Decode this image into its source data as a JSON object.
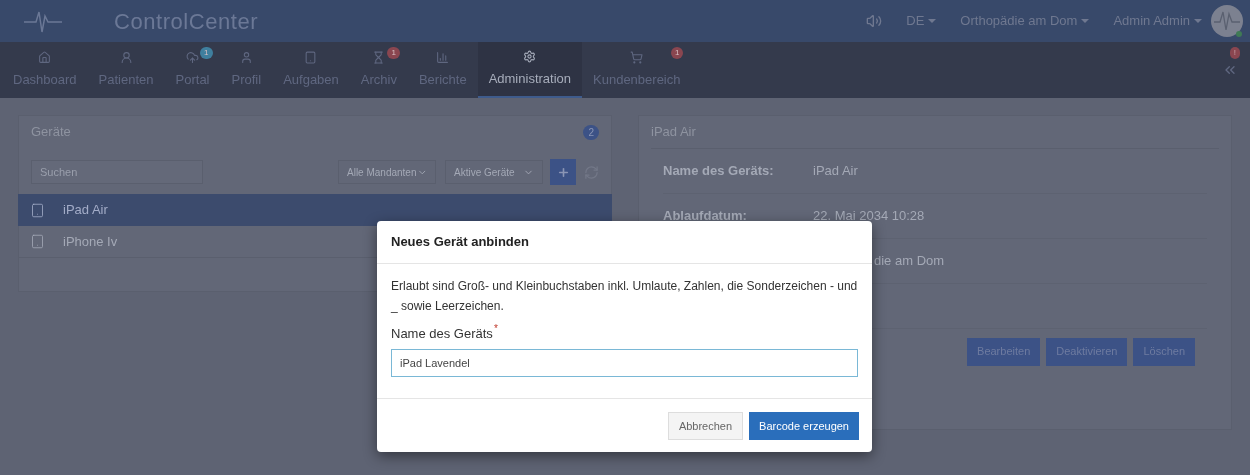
{
  "header": {
    "brand": "ControlCenter",
    "language": "DE",
    "practice": "Orthopädie am Dom",
    "user": "Admin Admin"
  },
  "nav": [
    {
      "label": "Dashboard",
      "selected": false
    },
    {
      "label": "Patienten",
      "selected": false
    },
    {
      "label": "Portal",
      "selected": false,
      "badge": "1",
      "color": "#3f7f9e"
    },
    {
      "label": "Profil",
      "selected": false
    },
    {
      "label": "Aufgaben",
      "selected": false
    },
    {
      "label": "Archiv",
      "selected": false,
      "badge": "1",
      "color": "#8a4650"
    },
    {
      "label": "Berichte",
      "selected": false
    },
    {
      "label": "Administration",
      "selected": true
    },
    {
      "label": "Kundenbereich",
      "selected": false,
      "badge": "1",
      "color": "#8a4650"
    }
  ],
  "collapse_badge": "!",
  "devices_panel": {
    "title": "Geräte",
    "count": "2",
    "search": {
      "placeholder": "Suchen"
    },
    "filters": [
      "Alle Mandanten",
      "Aktive Geräte"
    ],
    "items": [
      {
        "name": "iPad Air",
        "selected": true
      },
      {
        "name": "iPhone Iv",
        "selected": false
      }
    ]
  },
  "detail_panel": {
    "title": "iPad Air",
    "rows": [
      {
        "label": "Name des Geräts:",
        "value": "iPad Air"
      },
      {
        "label": "Ablaufdatum:",
        "value": "22. Mai 2034 10:28"
      },
      {
        "value": "die am Dom"
      }
    ],
    "buttons": [
      "Bearbeiten",
      "Deaktivieren",
      "Löschen"
    ]
  },
  "dialog": {
    "title": "Neues Gerät anbinden",
    "hint": "Erlaubt sind Groß- und Kleinbuchstaben inkl. Umlaute, Zahlen, die Sonderzeichen - und _ sowie Leerzeichen.",
    "field_label": "Name des Geräts",
    "required_mark": "*",
    "value": "iPad Lavendel",
    "cancel": "Abbrechen",
    "submit": "Barcode erzeugen"
  }
}
